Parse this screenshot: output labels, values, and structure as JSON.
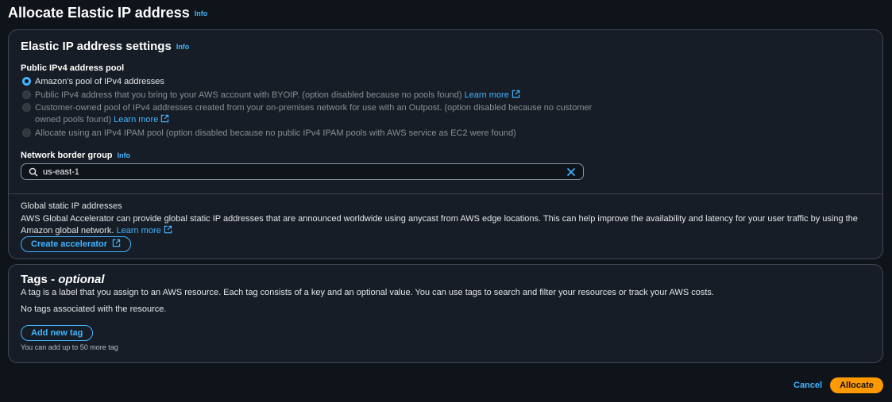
{
  "header": {
    "title": "Allocate Elastic IP address",
    "info": "Info"
  },
  "settings": {
    "title": "Elastic IP address settings",
    "info": "Info",
    "pool_label": "Public IPv4 address pool",
    "options": [
      {
        "label": "Amazon's pool of IPv4 addresses",
        "selected": true,
        "enabled": true,
        "link": ""
      },
      {
        "label": "Public IPv4 address that you bring to your AWS account with BYOIP. (option disabled because no pools found)",
        "selected": false,
        "enabled": false,
        "link": "Learn more"
      },
      {
        "label": "Customer-owned pool of IPv4 addresses created from your on-premises network for use with an Outpost. (option disabled because no customer owned pools found)",
        "selected": false,
        "enabled": false,
        "link": "Learn more"
      },
      {
        "label": "Allocate using an IPv4 IPAM pool (option disabled because no public IPv4 IPAM pools with AWS service as EC2 were found)",
        "selected": false,
        "enabled": false,
        "link": ""
      }
    ],
    "border_group_label": "Network border group",
    "border_group_info": "Info",
    "border_group_value": "us-east-1",
    "global_title": "Global static IP addresses",
    "global_desc": "AWS Global Accelerator can provide global static IP addresses that are announced worldwide using anycast from AWS edge locations. This can help improve the availability and latency for your user traffic by using the Amazon global network.",
    "global_link": "Learn more",
    "create_accelerator": "Create accelerator"
  },
  "tags": {
    "title": "Tags - ",
    "title_optional": "optional",
    "description": "A tag is a label that you assign to an AWS resource. Each tag consists of a key and an optional value. You can use tags to search and filter your resources or track your AWS costs.",
    "empty": "No tags associated with the resource.",
    "add_button": "Add new tag",
    "limit": "You can add up to 50 more tag"
  },
  "footer": {
    "cancel": "Cancel",
    "allocate": "Allocate"
  },
  "colors": {
    "accent": "#42b4ff",
    "primary": "#ff9900",
    "background": "#0f141a",
    "panel": "#161d26"
  }
}
